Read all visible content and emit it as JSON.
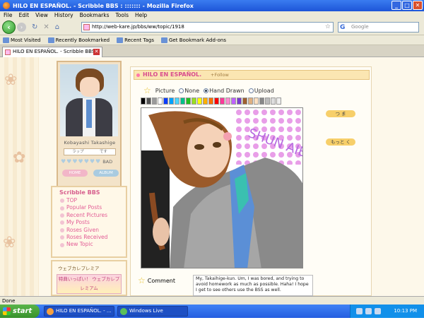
{
  "window": {
    "title": "HILO EN ESPAÑOL. - Scribble BBS : ::::::: - Mozilla Firefox"
  },
  "menu": [
    "File",
    "Edit",
    "View",
    "History",
    "Bookmarks",
    "Tools",
    "Help"
  ],
  "nav": {
    "url": "http://web-kare.jp/bbs/ww/topic/1918",
    "search_placeholder": "Google",
    "search_engine_letter": "G"
  },
  "bookmarks": [
    "Most Visited",
    "Recently Bookmarked",
    "Recent Tags",
    "Get Bookmark Add-ons"
  ],
  "tab": {
    "label": "HILO EN ESPAÑOL. - Scribble BBS : ::::::"
  },
  "profile": {
    "name": "Kobayashi Takashige",
    "box_left": "ラップ",
    "box_right": "です",
    "bad_label": "BAD",
    "btn_left": "HOME",
    "btn_right": "ALBUM"
  },
  "sidebar": {
    "title": "Scribble BBS",
    "items": [
      "TOP",
      "Popular Posts",
      "Recent Pictures",
      "My Posts",
      "Roses Given",
      "Roses Received",
      "New Topic"
    ]
  },
  "premia": {
    "heading": "ウェブカレプレミア",
    "banner": "特典いっぱい！ ウェブカレプレミアム"
  },
  "topic": {
    "title": "HILO EN ESPAÑOL.",
    "follow": "+Follow"
  },
  "options": {
    "picture": "Picture",
    "none": "None",
    "hand_drawn": "Hand Drawn",
    "upload": "Upload",
    "selected": "hand_drawn"
  },
  "canvas_buttons": {
    "top": "つ ま",
    "bottom": "もっと く"
  },
  "drawing_text": "SHUN AIBA",
  "comment": {
    "label": "Comment",
    "text": "My, Takaihige-kun. Um, I was bored, and trying to avoid homework as much as possible. Haha! I hope I get to see others use the BSS as well."
  },
  "palette": [
    "#000000",
    "#555555",
    "#9a9a9a",
    "#ffffff",
    "#0a3cff",
    "#00a2ff",
    "#4bd6ff",
    "#00c08a",
    "#20c020",
    "#9ae020",
    "#ffff00",
    "#ffb000",
    "#ff7000",
    "#ff0000",
    "#ff3a9a",
    "#ff8ad0",
    "#c060ff",
    "#7a3cd0",
    "#a06030",
    "#e0b080",
    "#ffe0c0",
    "#888888",
    "#bbbbbb",
    "#dddddd",
    "#eeeeee"
  ],
  "statusbar": {
    "text": "Done"
  },
  "taskbar": {
    "start": "start",
    "items": [
      "HILO EN ESPAÑOL. - ...",
      "Windows Live Messen..."
    ],
    "clock": "10:13 PM"
  }
}
